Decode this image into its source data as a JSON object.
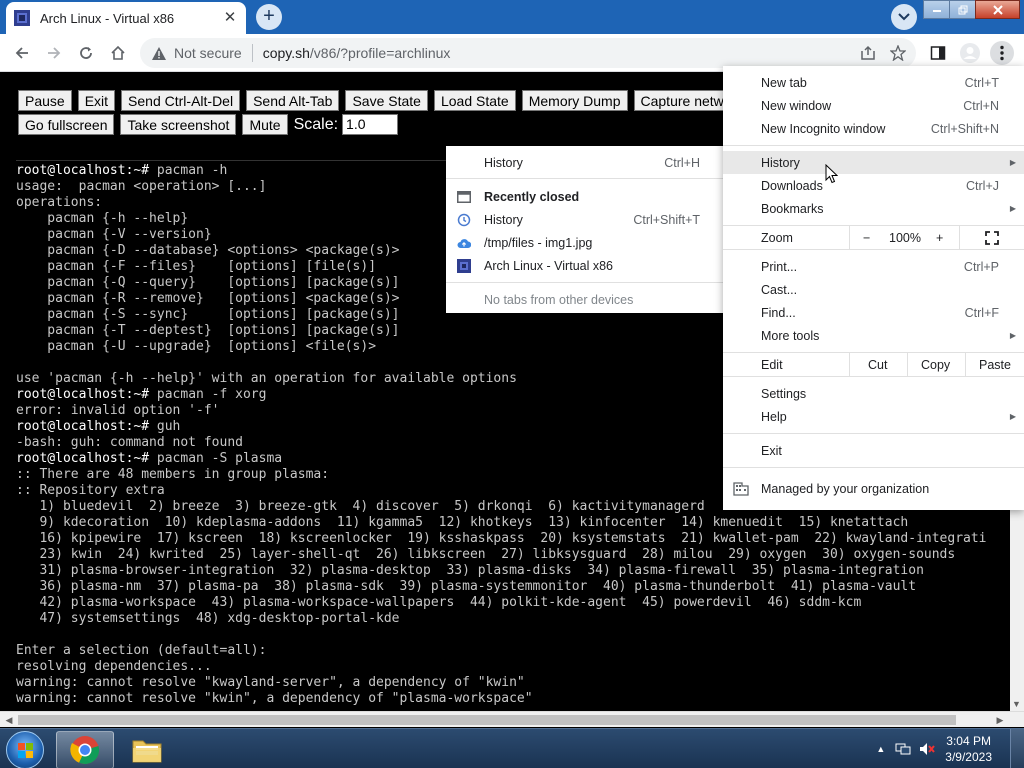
{
  "browser": {
    "tab_title": "Arch Linux - Virtual x86",
    "tab_close": "✕",
    "new_tab_glyph": "+",
    "security_label": "Not secure",
    "url_host": "copy.sh",
    "url_path": "/v86/?profile=archlinux"
  },
  "toolbar": {
    "buttons_row1": [
      "Pause",
      "Exit",
      "Send Ctrl-Alt-Del",
      "Send Alt-Tab",
      "Save State",
      "Load State",
      "Memory Dump",
      "Capture network"
    ],
    "buttons_row2": [
      "Go fullscreen",
      "Take screenshot",
      "Mute"
    ],
    "scale_label": "Scale:",
    "scale_value": "1.0"
  },
  "terminal": {
    "lines": [
      {
        "p": "root@localhost",
        "s": ":~# ",
        "t": "pacman -h"
      },
      {
        "t": "usage:  pacman <operation> [...]"
      },
      {
        "t": "operations:"
      },
      {
        "t": "    pacman {-h --help}"
      },
      {
        "t": "    pacman {-V --version}"
      },
      {
        "t": "    pacman {-D --database} <options> <package(s)>"
      },
      {
        "t": "    pacman {-F --files}    [options] [file(s)]"
      },
      {
        "t": "    pacman {-Q --query}    [options] [package(s)]"
      },
      {
        "t": "    pacman {-R --remove}   [options] <package(s)>"
      },
      {
        "t": "    pacman {-S --sync}     [options] [package(s)]"
      },
      {
        "t": "    pacman {-T --deptest}  [options] [package(s)]"
      },
      {
        "t": "    pacman {-U --upgrade}  [options] <file(s)>"
      },
      {
        "t": ""
      },
      {
        "t": "use 'pacman {-h --help}' with an operation for available options"
      },
      {
        "p": "root@localhost",
        "s": ":~# ",
        "t": "pacman -f xorg"
      },
      {
        "t": "error: invalid option '-f'"
      },
      {
        "p": "root@localhost",
        "s": ":~# ",
        "t": "guh"
      },
      {
        "t": "-bash: guh: command not found"
      },
      {
        "p": "root@localhost",
        "s": ":~# ",
        "t": "pacman -S plasma"
      },
      {
        "t": ":: There are 48 members in group plasma:"
      },
      {
        "t": ":: Repository extra"
      },
      {
        "t": "   1) bluedevil  2) breeze  3) breeze-gtk  4) discover  5) drkonqi  6) kactivitymanagerd"
      },
      {
        "t": "   9) kdecoration  10) kdeplasma-addons  11) kgamma5  12) khotkeys  13) kinfocenter  14) kmenuedit  15) knetattach"
      },
      {
        "t": "   16) kpipewire  17) kscreen  18) kscreenlocker  19) ksshaskpass  20) ksystemstats  21) kwallet-pam  22) kwayland-integrati"
      },
      {
        "t": "   23) kwin  24) kwrited  25) layer-shell-qt  26) libkscreen  27) libksysguard  28) milou  29) oxygen  30) oxygen-sounds"
      },
      {
        "t": "   31) plasma-browser-integration  32) plasma-desktop  33) plasma-disks  34) plasma-firewall  35) plasma-integration"
      },
      {
        "t": "   36) plasma-nm  37) plasma-pa  38) plasma-sdk  39) plasma-systemmonitor  40) plasma-thunderbolt  41) plasma-vault"
      },
      {
        "t": "   42) plasma-workspace  43) plasma-workspace-wallpapers  44) polkit-kde-agent  45) powerdevil  46) sddm-kcm"
      },
      {
        "t": "   47) systemsettings  48) xdg-desktop-portal-kde"
      },
      {
        "t": ""
      },
      {
        "t": "Enter a selection (default=all):"
      },
      {
        "t": "resolving dependencies..."
      },
      {
        "t": "warning: cannot resolve \"kwayland-server\", a dependency of \"kwin\""
      },
      {
        "t": "warning: cannot resolve \"kwin\", a dependency of \"plasma-workspace\""
      },
      {
        "t": ":: There are 3 providers available for phonon-qt5-backend:"
      }
    ]
  },
  "chrome_menu": {
    "new_tab": {
      "label": "New tab",
      "shortcut": "Ctrl+T"
    },
    "new_window": {
      "label": "New window",
      "shortcut": "Ctrl+N"
    },
    "new_incognito": {
      "label": "New Incognito window",
      "shortcut": "Ctrl+Shift+N"
    },
    "history": {
      "label": "History"
    },
    "downloads": {
      "label": "Downloads",
      "shortcut": "Ctrl+J"
    },
    "bookmarks": {
      "label": "Bookmarks"
    },
    "zoom": {
      "label": "Zoom",
      "minus": "−",
      "value": "100%",
      "plus": "+"
    },
    "print": {
      "label": "Print...",
      "shortcut": "Ctrl+P"
    },
    "cast": {
      "label": "Cast..."
    },
    "find": {
      "label": "Find...",
      "shortcut": "Ctrl+F"
    },
    "more_tools": {
      "label": "More tools"
    },
    "edit": {
      "label": "Edit",
      "cut": "Cut",
      "copy": "Copy",
      "paste": "Paste"
    },
    "settings": {
      "label": "Settings"
    },
    "help": {
      "label": "Help"
    },
    "exit": {
      "label": "Exit"
    },
    "managed": {
      "label": "Managed by your organization"
    }
  },
  "history_menu": {
    "history": {
      "label": "History",
      "shortcut": "Ctrl+H"
    },
    "recently_closed": "Recently closed",
    "items": [
      {
        "label": "History",
        "shortcut": "Ctrl+Shift+T",
        "icon": "history-icon"
      },
      {
        "label": "/tmp/files - img1.jpg",
        "shortcut": "",
        "icon": "cloud-upload-icon"
      },
      {
        "label": "Arch Linux - Virtual x86",
        "shortcut": "",
        "icon": "v86-favicon-icon"
      }
    ],
    "no_tabs": "No tabs from other devices"
  },
  "taskbar": {
    "time": "3:04 PM",
    "date": "3/9/2023"
  },
  "colors": {
    "tabstrip": "#1e64b5",
    "terminal_bg": "#000000",
    "terminal_fg": "#c8c8c8",
    "menu_highlight": "#e8e8e8"
  }
}
